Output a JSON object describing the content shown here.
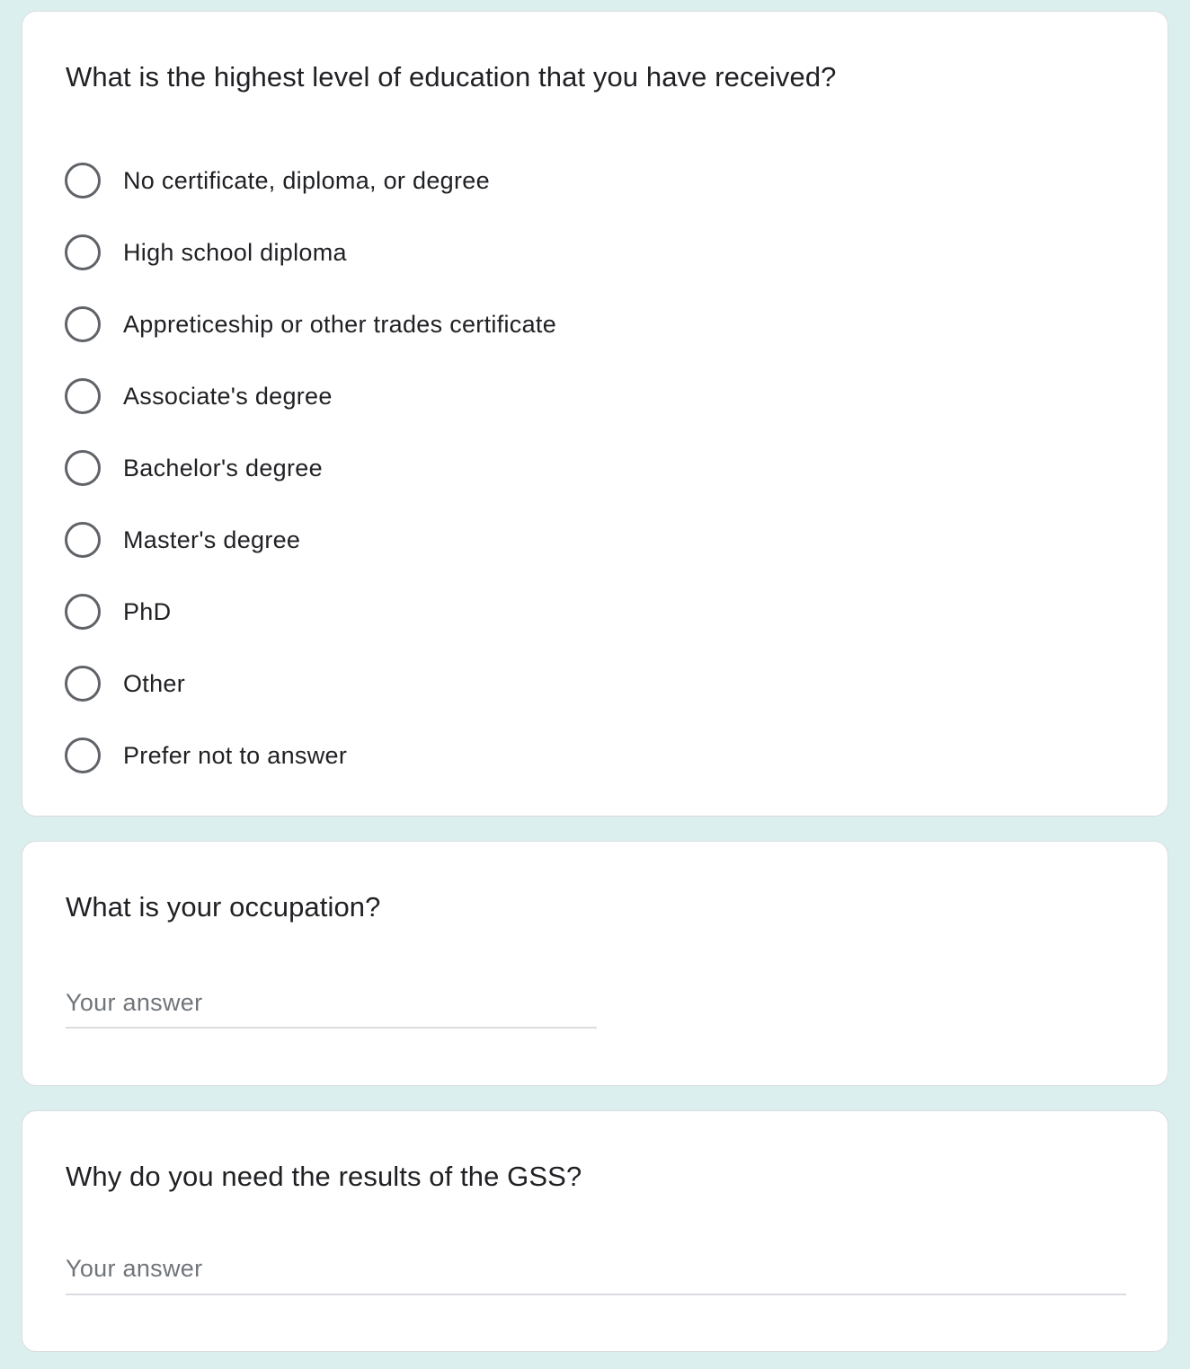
{
  "education": {
    "question": "What is the highest level of education that you have received?",
    "options": [
      {
        "label": "No certificate, diploma, or degree",
        "selected": false
      },
      {
        "label": "High school diploma",
        "selected": false
      },
      {
        "label": "Appreticeship or other trades certificate",
        "selected": false
      },
      {
        "label": "Associate's degree",
        "selected": false
      },
      {
        "label": "Bachelor's degree",
        "selected": false
      },
      {
        "label": "Master's degree",
        "selected": false
      },
      {
        "label": "PhD",
        "selected": false
      },
      {
        "label": "Other",
        "selected": false
      },
      {
        "label": "Prefer not to answer",
        "selected": false
      }
    ]
  },
  "occupation": {
    "question": "What is your occupation?",
    "value": "",
    "placeholder": "Your answer"
  },
  "reason": {
    "question": "Why do you need the results of the GSS?",
    "value": "",
    "placeholder": "Your answer"
  },
  "colors": {
    "background": "#dbefee",
    "card": "#ffffff",
    "radio_border": "#5f6368",
    "text": "#202124",
    "placeholder": "#70757a",
    "underline": "#dadce0"
  }
}
